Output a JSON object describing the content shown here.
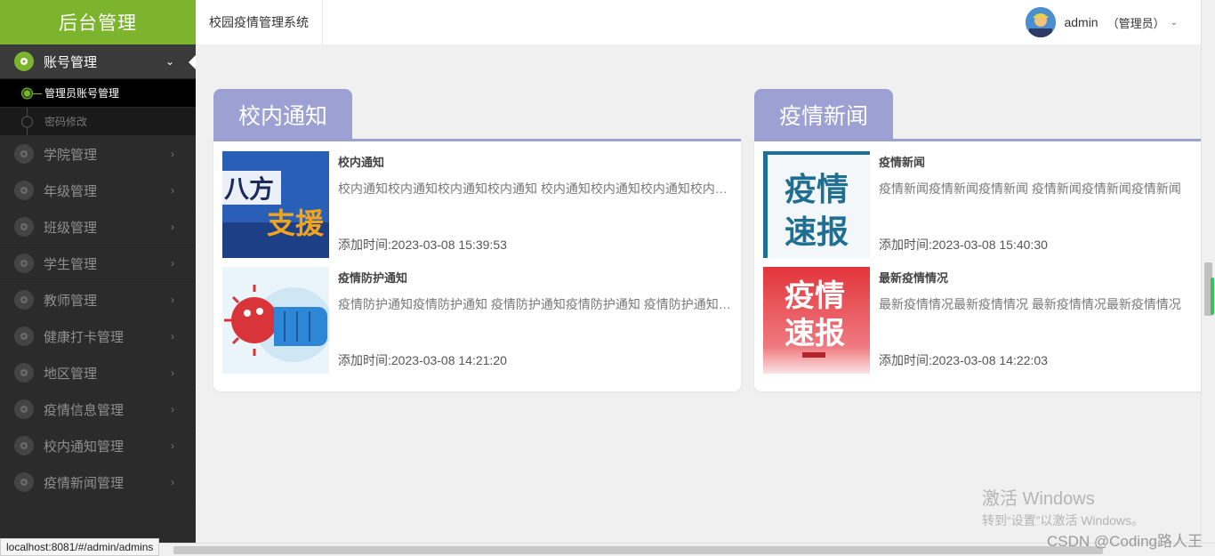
{
  "brand": "后台管理",
  "topbar": {
    "system_title": "校园疫情管理系统",
    "username": "admin",
    "role": "（管理员）"
  },
  "sidebar": {
    "open_group": {
      "label": "账号管理",
      "subitems": [
        "管理员账号管理",
        "密码修改"
      ]
    },
    "items": [
      "学院管理",
      "年级管理",
      "班级管理",
      "学生管理",
      "教师管理",
      "健康打卡管理",
      "地区管理",
      "疫情信息管理",
      "校内通知管理",
      "疫情新闻管理"
    ]
  },
  "cards": [
    {
      "tab": "校内通知",
      "news": [
        {
          "title": "校内通知",
          "text": "校内通知校内通知校内通知校内通知 校内通知校内通知校内通知校内通知 校内通知",
          "time": "添加时间:2023-03-08 15:39:53",
          "image": "support-banner-image"
        },
        {
          "title": "疫情防护通知",
          "text": "疫情防护通知疫情防护通知 疫情防护通知疫情防护通知 疫情防护通知疫情防护通知",
          "time": "添加时间:2023-03-08 14:21:20",
          "image": "virus-fist-image"
        }
      ]
    },
    {
      "tab": "疫情新闻",
      "news": [
        {
          "title": "疫情新闻",
          "text": "疫情新闻疫情新闻疫情新闻 疫情新闻疫情新闻疫情新闻",
          "time": "添加时间:2023-03-08 15:40:30",
          "image": "epidemic-report-blue-image"
        },
        {
          "title": "最新疫情情况",
          "text": "最新疫情情况最新疫情情况 最新疫情情况最新疫情情况",
          "time": "添加时间:2023-03-08 14:22:03",
          "image": "epidemic-report-red-image"
        }
      ]
    }
  ],
  "images": {
    "support_text_a": "八方",
    "support_text_b": "支援",
    "report_line1": "疫情",
    "report_line2": "速报"
  },
  "status_url": "localhost:8081/#/admin/admins",
  "watermark": {
    "line1": "激活 Windows",
    "line2": "转到“设置”以激活 Windows。"
  },
  "csdn": "CSDN @Coding路人王",
  "colors": {
    "brand_green": "#7cb42e",
    "tab_purple": "#9da0d2",
    "sidebar_bg": "#2b2b2b"
  }
}
